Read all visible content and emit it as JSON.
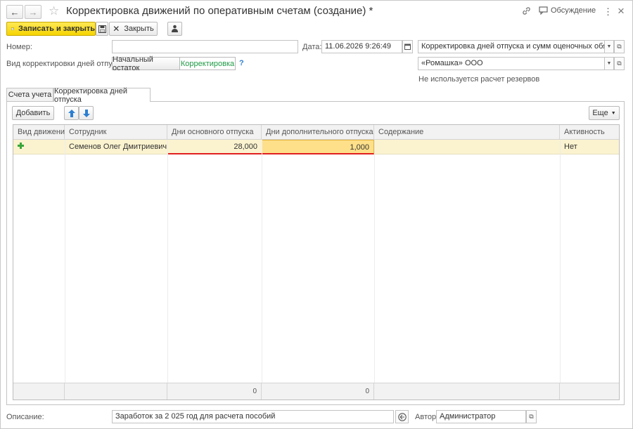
{
  "window": {
    "title": "Корректировка движений по оперативным счетам (создание) *",
    "discussion_label": "Обсуждение",
    "more_icon": "⋮",
    "close_icon": "×"
  },
  "toolbar": {
    "save_close_label": "Записать и закрыть",
    "close_label": "Закрыть"
  },
  "header": {
    "number_label": "Номер:",
    "number_value": "",
    "date_label": "Дата:",
    "date_value": "11.06.2026  9:26:49",
    "op_type_value": "Корректировка дней отпуска и сумм оценочных обязательств",
    "vid_label": "Вид корректировки  дней отпуска:",
    "vid_options": [
      "Начальный остаток",
      "Корректировка"
    ],
    "vid_selected": "Корректировка",
    "help_mark": "?",
    "org_value": "«Ромашка» ООО",
    "reserve_note": "Не используется расчет резервов"
  },
  "tabs": [
    {
      "label": "Счета учета",
      "active": false
    },
    {
      "label": "Корректировка дней отпуска",
      "active": true
    }
  ],
  "table_toolbar": {
    "add_label": "Добавить",
    "more_label": "Еще"
  },
  "table": {
    "columns": [
      "Вид движения",
      "Сотрудник",
      "Дни основного отпуска",
      "Дни дополнительного отпуска",
      "Содержание",
      "Активность"
    ],
    "rows": [
      {
        "movement_icon": "plus-icon",
        "employee": "Семенов Олег Дмитриевич",
        "main_days": "28,000",
        "extra_days": "1,000",
        "content": "",
        "active": "Нет"
      }
    ],
    "totals": {
      "main_days": "0",
      "extra_days": "0"
    }
  },
  "bottom": {
    "description_label": "Описание:",
    "description_value": "Заработок за 2 025 год для расчета пособий",
    "author_label": "Автор:",
    "author_value": "Администратор"
  },
  "colors": {
    "primary_button": "#f5d400",
    "selected_row": "#fbf3cf",
    "active_cell": "#ffe08a",
    "accent_green": "#1e9b45",
    "accent_blue": "#2d7fd1",
    "error_underline": "#e02020"
  }
}
